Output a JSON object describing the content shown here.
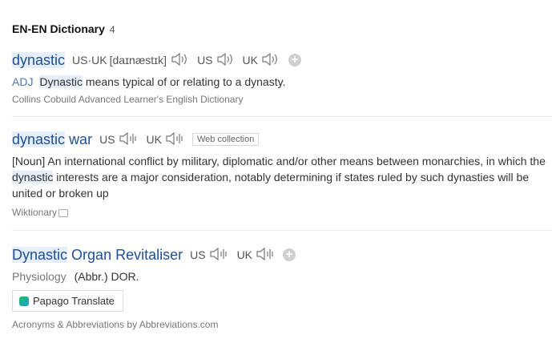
{
  "section": {
    "title": "EN-EN Dictionary",
    "count": "4"
  },
  "entries": [
    {
      "word": "dynastic",
      "pron_both_label": "US·UK",
      "phonetic": "[daɪnæstɪk]",
      "us_label": "US",
      "uk_label": "UK",
      "pos": "ADJ",
      "def_word": "Dynastic",
      "def_rest": " means typical of or relating to a dynasty.",
      "source": "Collins Cobuild Advanced Learner's English Dictionary"
    },
    {
      "word_hl": "dynastic",
      "word_rest": "war",
      "us_label": "US",
      "uk_label": "UK",
      "tag": "Web collection",
      "def_pre": "[Noun] An international conflict by military, diplomatic and/or other means between monarchies, in which the ",
      "def_hl": "dynastic",
      "def_post": " interests are a major consideration, notably determining if states ruled by such dynasties will be united or broken up",
      "source": "Wiktionary"
    },
    {
      "word_hl": "Dynastic",
      "word_rest": "Organ Revitaliser",
      "us_label": "US",
      "uk_label": "UK",
      "field": "Physiology",
      "def": "(Abbr.) DOR.",
      "papago_label": "Papago Translate",
      "source": "Acronyms & Abbreviations by Abbreviations.com"
    }
  ],
  "colors": {
    "link": "#1a50a0",
    "highlight": "#e6eef9",
    "pos": "#4a78b8"
  },
  "icons": [
    "speaker-icon",
    "plus-icon",
    "external-link-icon",
    "papago-logo-icon"
  ]
}
